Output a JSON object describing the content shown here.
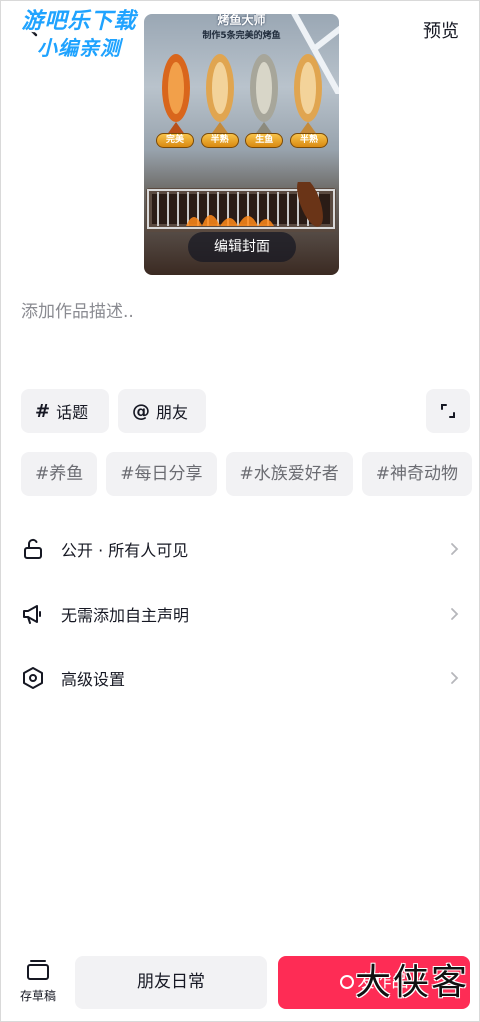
{
  "watermark": {
    "line1": "游吧乐下载",
    "line2": "小编亲测"
  },
  "header": {
    "preview_label": "预览"
  },
  "cover": {
    "game_title": "烤鱼大师",
    "game_subtitle": "制作5条完美的烤鱼",
    "fish_labels": [
      "完美",
      "半熟",
      "生鱼",
      "半熟"
    ],
    "edit_label": "编辑封面"
  },
  "description": {
    "placeholder": "添加作品描述.."
  },
  "chips": {
    "topic_label": "话题",
    "friend_label": "朋友"
  },
  "hashtags": [
    "#养鱼",
    "#每日分享",
    "#水族爱好者",
    "#神奇动物"
  ],
  "settings": [
    {
      "label": "公开 · 所有人可见",
      "icon": "lock-open-icon"
    },
    {
      "label": "无需添加自主声明",
      "icon": "megaphone-icon"
    },
    {
      "label": "高级设置",
      "icon": "hexagon-settings-icon"
    }
  ],
  "bottom": {
    "drafts_label": "存草稿",
    "daily_label": "朋友日常",
    "publish_label": "发作品",
    "corner_mark": "大侠客"
  },
  "colors": {
    "accent": "#fe2c55",
    "chip_bg": "#f2f2f4",
    "text": "#161823",
    "muted": "#8a8b91"
  }
}
